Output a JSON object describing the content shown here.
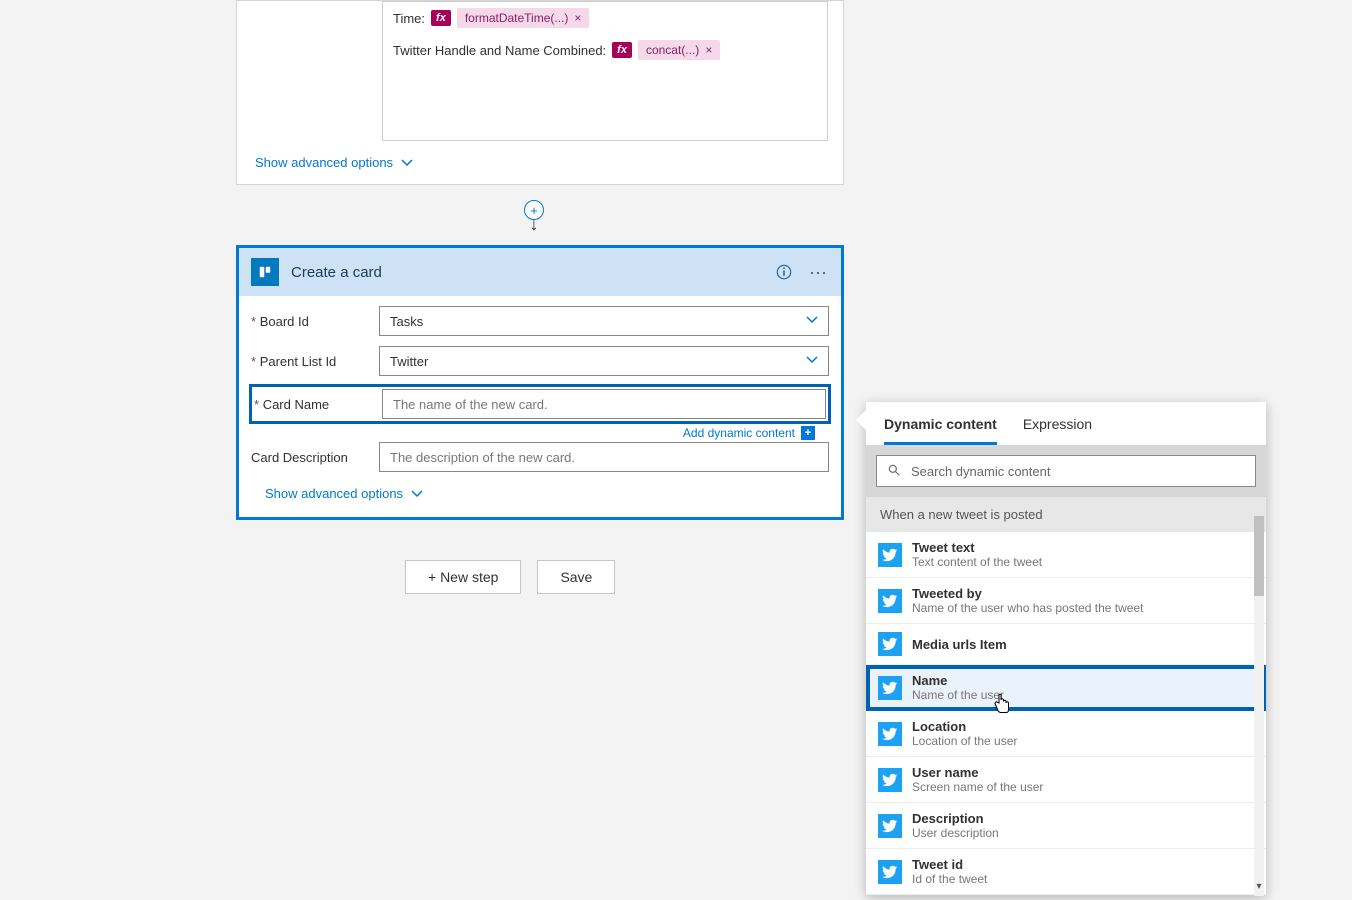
{
  "compose": {
    "time_label": "Time:",
    "time_token": "formatDateTime(...)",
    "handle_label": "Twitter Handle and Name Combined:",
    "handle_token": "concat(...)",
    "show_advanced": "Show advanced options"
  },
  "action": {
    "title": "Create a card",
    "board_label": "Board Id",
    "board_value": "Tasks",
    "parent_label": "Parent List Id",
    "parent_value": "Twitter",
    "cardname_label": "Card Name",
    "cardname_placeholder": "The name of the new card.",
    "carddesc_label": "Card Description",
    "carddesc_placeholder": "The description of the new card.",
    "add_dynamic": "Add dynamic content",
    "show_advanced": "Show advanced options"
  },
  "buttons": {
    "new_step": "+ New step",
    "save": "Save"
  },
  "dyn": {
    "tab_dynamic": "Dynamic content",
    "tab_expression": "Expression",
    "search_placeholder": "Search dynamic content",
    "trigger_label": "When a new tweet is posted",
    "items": [
      {
        "title": "Tweet text",
        "sub": "Text content of the tweet"
      },
      {
        "title": "Tweeted by",
        "sub": "Name of the user who has posted the tweet"
      },
      {
        "title": "Media urls Item",
        "sub": ""
      },
      {
        "title": "Name",
        "sub": "Name of the user"
      },
      {
        "title": "Location",
        "sub": "Location of the user"
      },
      {
        "title": "User name",
        "sub": "Screen name of the user"
      },
      {
        "title": "Description",
        "sub": "User description"
      },
      {
        "title": "Tweet id",
        "sub": "Id of the tweet"
      }
    ]
  }
}
